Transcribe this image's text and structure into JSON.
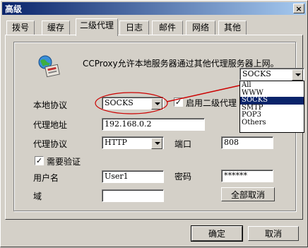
{
  "window": {
    "title": "高级",
    "close_glyph": "×"
  },
  "tabs": [
    "拨号",
    "缓存",
    "二级代理",
    "日志",
    "邮件",
    "网络",
    "其他"
  ],
  "active_tab": "二级代理",
  "info_text": "CCProxy允许本地服务器通过其他代理服务器上网。",
  "upstream_combo": {
    "value": "SOCKS"
  },
  "dropdown_options": [
    "All",
    "WWW",
    "SOCKS",
    "SMTP",
    "POP3",
    "Others"
  ],
  "dropdown_selected": "SOCKS",
  "form": {
    "local_protocol_label": "本地协议",
    "local_protocol_value": "SOCKS",
    "enable_secondary_label": "启用二级代理",
    "enable_secondary_checked": "✓",
    "proxy_address_label": "代理地址",
    "proxy_address_value": "192.168.0.2",
    "proxy_protocol_label": "代理协议",
    "proxy_protocol_value": "HTTP",
    "port_label": "端口",
    "port_value": "808",
    "auth_label": "需要验证",
    "auth_checked": "✓",
    "username_label": "用户名",
    "username_value": "User1",
    "password_label": "密码",
    "password_value": "******",
    "domain_label": "域",
    "domain_value": "",
    "cancel_all_label": "全部取消"
  },
  "footer": {
    "ok_label": "确定",
    "cancel_label": "取消"
  },
  "colors": {
    "titlebar_start": "#0a246a",
    "titlebar_end": "#a6caf0",
    "highlight_ellipse": "#cc0000",
    "selection": "#0a246a"
  }
}
